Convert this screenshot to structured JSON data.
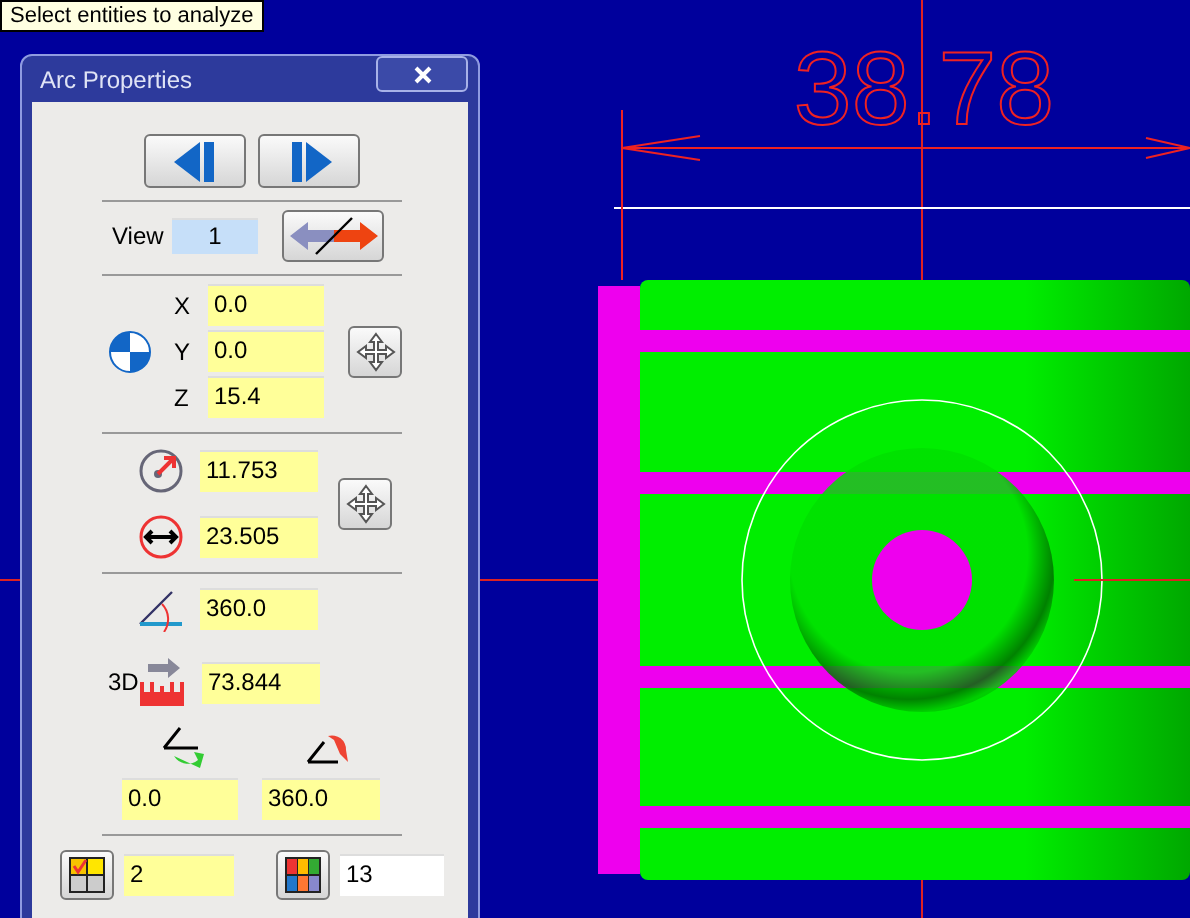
{
  "tooltip": "Select entities to analyze",
  "window": {
    "title": "Arc Properties"
  },
  "view": {
    "label": "View",
    "value": "1"
  },
  "center": [
    {
      "label": "X",
      "value": "0.0"
    },
    {
      "label": "Y",
      "value": "0.0"
    },
    {
      "label": "Z",
      "value": "15.4"
    }
  ],
  "radius": {
    "value": "11.753"
  },
  "diameter": {
    "value": "23.505"
  },
  "angle": {
    "value": "360.0"
  },
  "length": {
    "label": "3D",
    "value": "73.844"
  },
  "start_angle": {
    "value": "0.0"
  },
  "end_angle": {
    "value": "360.0"
  },
  "bottom_fields": [
    {
      "kind": "readout",
      "value": "2"
    },
    {
      "kind": "input",
      "value": "13"
    }
  ],
  "viewport": {
    "dimension": "38.78"
  }
}
